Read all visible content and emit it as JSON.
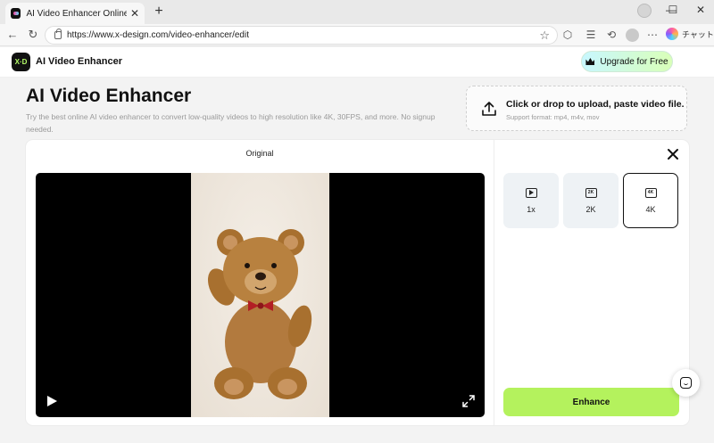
{
  "browser": {
    "tab_title": "AI Video Enhancer Online | X-Design",
    "tab_close": "✕",
    "new_tab": "+",
    "url": "https://www.x-design.com/video-enhancer/edit",
    "chat_label": "チャット",
    "window_controls": {
      "minimize": "—",
      "maximize": "☐",
      "close": "✕"
    }
  },
  "header": {
    "logo_text": "X·D",
    "brand": "AI Video Enhancer",
    "upgrade_label": "Upgrade for Free"
  },
  "hero": {
    "title": "AI Video Enhancer",
    "description": "Try the best online AI video enhancer to convert low-quality videos to high resolution like 4K, 30FPS, and more. No signup needed."
  },
  "upload": {
    "title": "Click or drop to upload, paste video file.",
    "subtitle": "Support format: mp4, m4v, mov"
  },
  "workspace": {
    "pane_label": "Original",
    "scale_options": [
      {
        "label": "1x",
        "icon": "play-icon",
        "selected": false
      },
      {
        "label": "2K",
        "icon": "2k-icon",
        "selected": false
      },
      {
        "label": "4K",
        "icon": "4k-icon",
        "selected": true
      }
    ],
    "enhance_label": "Enhance"
  },
  "colors": {
    "accent": "#b4f25d",
    "upgrade_gradient_start": "#c8f7ff",
    "upgrade_gradient_end": "#d9ffb8"
  }
}
